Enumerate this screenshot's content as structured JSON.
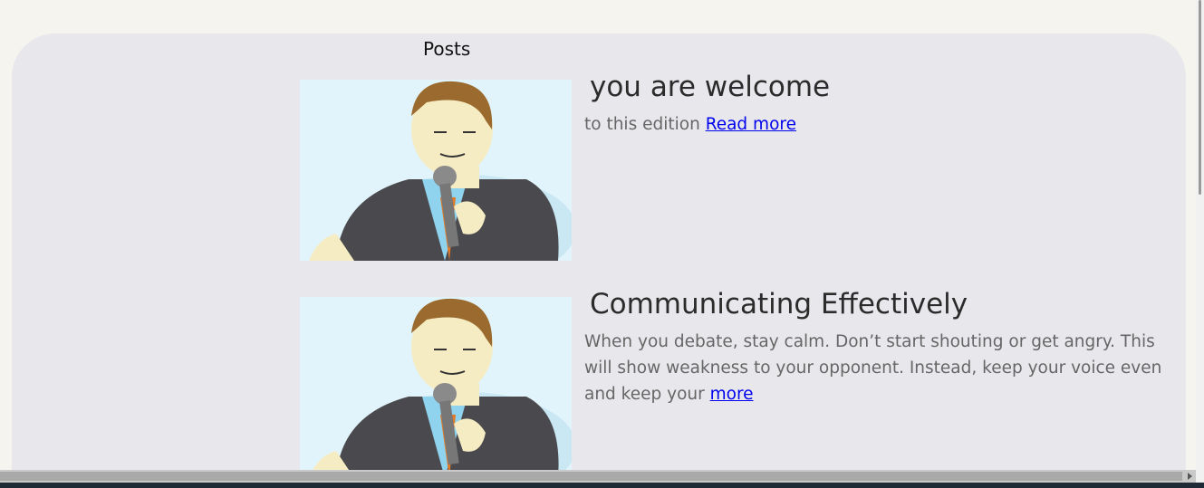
{
  "section_title": "Posts",
  "posts": [
    {
      "title": "you are welcome",
      "excerpt": "to this edition ",
      "link": "Read more"
    },
    {
      "title": "Communicating Effectively",
      "excerpt": "When you debate, stay calm. Don’t start shouting or get angry. This will show weakness to your opponent. Instead, keep your voice even and keep your ",
      "link": "more"
    }
  ],
  "colors": {
    "page_bg": "#f5f4ee",
    "panel_bg": "#e8e8ec",
    "link": "#0000ee"
  }
}
